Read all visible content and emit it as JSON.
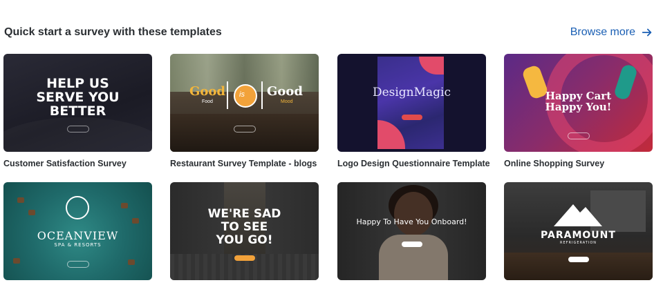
{
  "header": {
    "title": "Quick start a survey with these templates",
    "browse_label": "Browse more"
  },
  "templates": [
    {
      "caption": "Customer Satisfaction Survey",
      "headline_lines": [
        "HELP US",
        "SERVE YOU",
        "BETTER"
      ]
    },
    {
      "caption": "Restaurant Survey Template - blogs",
      "logo_left": "Good",
      "logo_left_sub": "Food",
      "logo_right": "Good",
      "logo_right_sub": "Mood",
      "logo_center": "is"
    },
    {
      "caption": "Logo Design Questionnaire Template",
      "headline": "DesignMagic"
    },
    {
      "caption": "Online Shopping Survey",
      "headline_lines": [
        "Happy Cart",
        "Happy You!"
      ]
    },
    {
      "caption": "",
      "headline": "OCEANVIEW",
      "subheadline": "SPA & RESORTS"
    },
    {
      "caption": "",
      "headline_lines": [
        "WE'RE SAD",
        "TO SEE",
        "YOU GO!"
      ]
    },
    {
      "caption": "",
      "headline": "Happy To Have You Onboard!"
    },
    {
      "caption": "",
      "headline": "PARAMOUNT",
      "subheadline": "REFRIGERATION"
    }
  ],
  "colors": {
    "link": "#1a5fb4",
    "caption": "#2b2f33",
    "accent_red": "#e24b4b",
    "accent_orange": "#f2a23a"
  }
}
